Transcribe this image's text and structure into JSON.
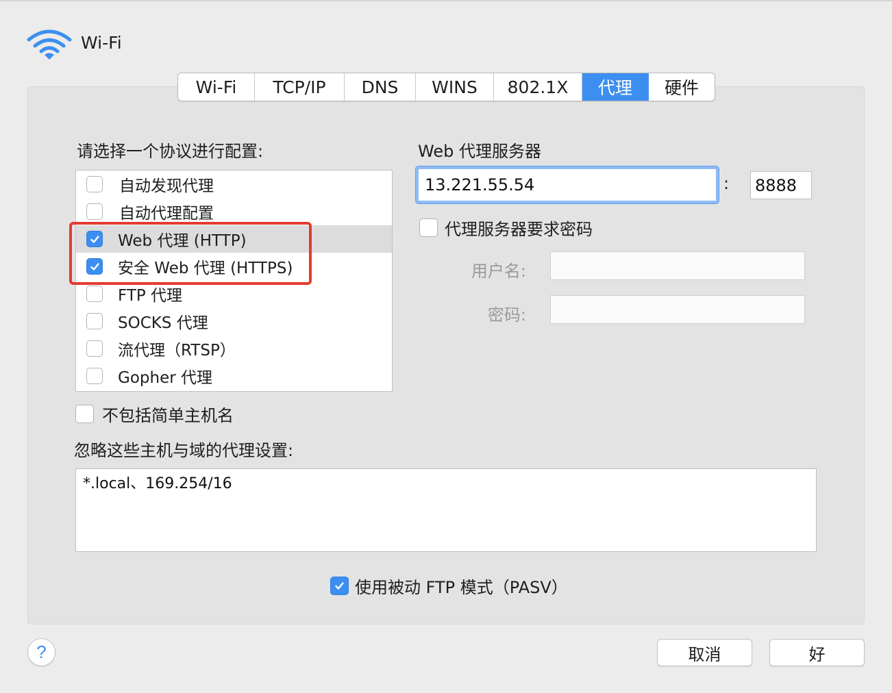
{
  "window": {
    "title": "Wi-Fi"
  },
  "tabs": [
    {
      "label": "Wi-Fi",
      "active": false
    },
    {
      "label": "TCP/IP",
      "active": false
    },
    {
      "label": "DNS",
      "active": false
    },
    {
      "label": "WINS",
      "active": false
    },
    {
      "label": "802.1X",
      "active": false
    },
    {
      "label": "代理",
      "active": true
    },
    {
      "label": "硬件",
      "active": false
    }
  ],
  "protocols": {
    "heading": "请选择一个协议进行配置:",
    "items": [
      {
        "label": "自动发现代理",
        "checked": false
      },
      {
        "label": "自动代理配置",
        "checked": false
      },
      {
        "label": "Web 代理 (HTTP)",
        "checked": true,
        "selected": true
      },
      {
        "label": "安全 Web 代理 (HTTPS)",
        "checked": true
      },
      {
        "label": "FTP 代理",
        "checked": false
      },
      {
        "label": "SOCKS 代理",
        "checked": false
      },
      {
        "label": "流代理（RTSP）",
        "checked": false
      },
      {
        "label": "Gopher 代理",
        "checked": false
      }
    ]
  },
  "server": {
    "heading": "Web 代理服务器",
    "address": "13.221.55.54",
    "colon": ":",
    "port": "8888",
    "require_password": {
      "label": "代理服务器要求密码",
      "checked": false
    },
    "username_label": "用户名:",
    "username_value": "",
    "password_label": "密码:",
    "password_value": ""
  },
  "exclude_simple_hostnames": {
    "label": "不包括简单主机名",
    "checked": false
  },
  "bypass": {
    "label": "忽略这些主机与域的代理设置:",
    "value": "*.local、169.254/16"
  },
  "passive_ftp": {
    "label": "使用被动 FTP 模式（PASV）",
    "checked": true
  },
  "buttons": {
    "help": "?",
    "cancel": "取消",
    "ok": "好"
  },
  "colors": {
    "accent": "#3c8ff0",
    "annotation": "#e33b2f",
    "panel": "#e3e3e3"
  }
}
